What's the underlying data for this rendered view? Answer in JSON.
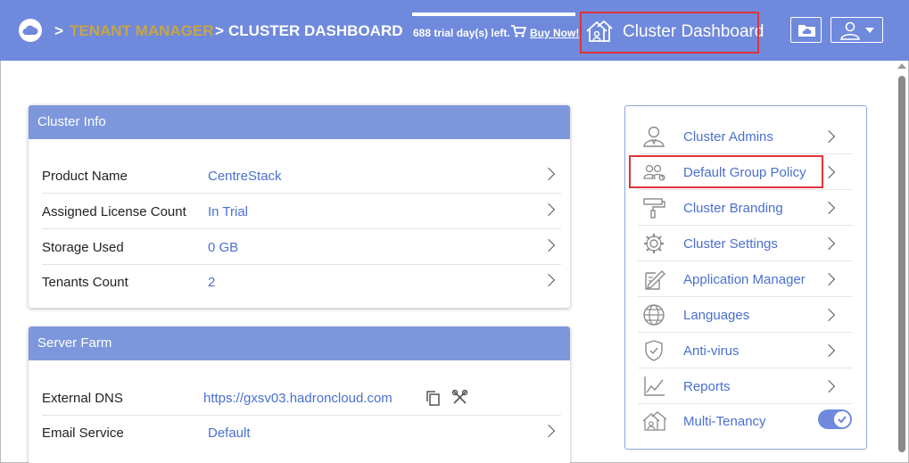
{
  "header": {
    "breadcrumb_sep1": ">",
    "breadcrumb_tenant": "TENANT MANAGER",
    "breadcrumb_sep2": ">",
    "breadcrumb_current": "CLUSTER DASHBOARD",
    "trial_text": "688 trial day(s) left.",
    "buy_now": "Buy Now!",
    "dashboard_title": "Cluster Dashboard",
    "colors": {
      "bar": "#6f89dc",
      "tenant_link": "#c8a542",
      "highlight": "#e0343a"
    }
  },
  "cluster_info": {
    "title": "Cluster Info",
    "rows": [
      {
        "label": "Product Name",
        "value": "CentreStack"
      },
      {
        "label": "Assigned License Count",
        "value": "In Trial"
      },
      {
        "label": "Storage Used",
        "value": "0 GB"
      },
      {
        "label": "Tenants Count",
        "value": "2"
      }
    ]
  },
  "server_farm": {
    "title": "Server Farm",
    "rows": [
      {
        "label": "External DNS",
        "value": "https://gxsv03.hadroncloud.com"
      },
      {
        "label": "Email Service",
        "value": "Default"
      }
    ]
  },
  "menu": {
    "items": [
      {
        "label": "Cluster Admins",
        "icon": "admin-user-icon"
      },
      {
        "label": "Default Group Policy",
        "icon": "group-policy-icon"
      },
      {
        "label": "Cluster Branding",
        "icon": "paint-roller-icon"
      },
      {
        "label": "Cluster Settings",
        "icon": "gear-icon"
      },
      {
        "label": "Application Manager",
        "icon": "app-manager-icon"
      },
      {
        "label": "Languages",
        "icon": "globe-icon"
      },
      {
        "label": "Anti-virus",
        "icon": "shield-icon"
      },
      {
        "label": "Reports",
        "icon": "chart-icon"
      },
      {
        "label": "Multi-Tenancy",
        "icon": "multi-tenancy-icon"
      }
    ],
    "multi_tenancy_enabled": true
  }
}
